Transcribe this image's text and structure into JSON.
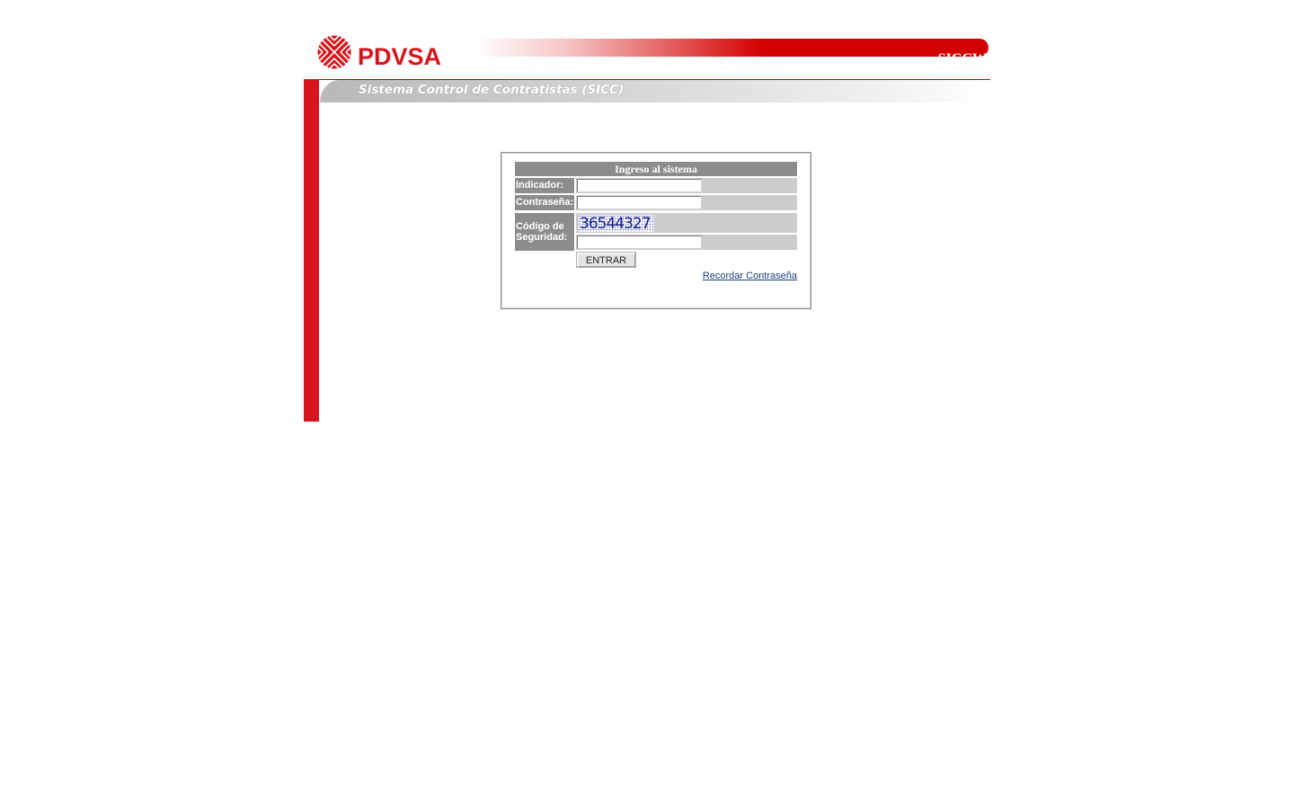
{
  "header": {
    "logo_text": "PDVSA",
    "app_code": "SICCW",
    "system_title": "Sistema Control de Contratistas (SICC)"
  },
  "login": {
    "heading": "Ingreso al sistema",
    "indicador_label": "Indicador:",
    "indicador_value": "",
    "contrasena_label": "Contraseña:",
    "contrasena_value": "",
    "codigo_label_line1": "Código de",
    "codigo_label_line2": "Seguridad:",
    "captcha_text": "36544327",
    "codigo_value": "",
    "submit_label": "ENTRAR",
    "recordar_label": "Recordar Contraseña"
  },
  "colors": {
    "brand_red": "#d7141c",
    "panel_gray": "#8c8c8c",
    "field_gray": "#cccccc",
    "link_blue": "#1a3c7a"
  },
  "icons": {
    "logo": "pdvsa-sun-logo-icon"
  }
}
